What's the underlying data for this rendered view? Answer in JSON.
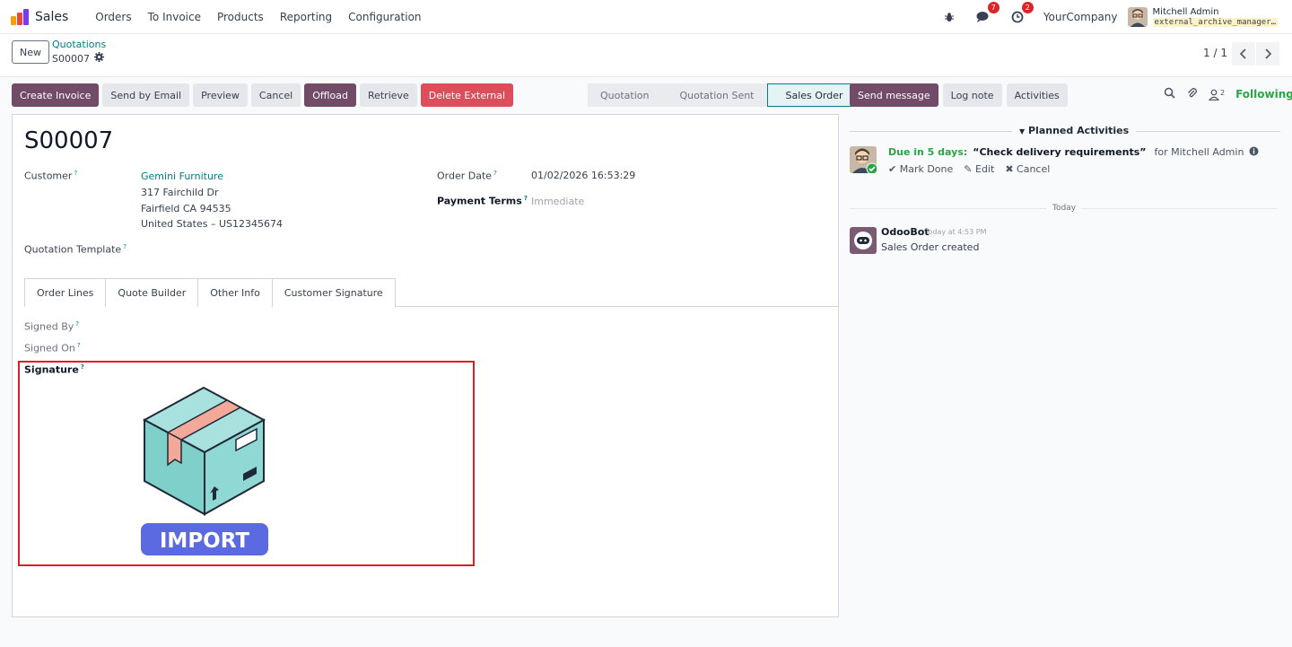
{
  "navbar": {
    "app_name": "Sales",
    "menu": [
      "Orders",
      "To Invoice",
      "Products",
      "Reporting",
      "Configuration"
    ],
    "messages_badge": "7",
    "activities_badge": "2",
    "company": "YourCompany",
    "user_name": "Mitchell Admin",
    "database": "external_archive_manager…"
  },
  "control_panel": {
    "new_label": "New",
    "breadcrumb_parent": "Quotations",
    "breadcrumb_current": "S00007",
    "pager": "1 / 1"
  },
  "actions": {
    "create_invoice": "Create Invoice",
    "send_by_email": "Send by Email",
    "preview": "Preview",
    "cancel": "Cancel",
    "offload": "Offload",
    "retrieve": "Retrieve",
    "delete_external": "Delete External"
  },
  "statusbar": [
    "Quotation",
    "Quotation Sent",
    "Sales Order"
  ],
  "form": {
    "title": "S00007",
    "customer_label": "Customer",
    "customer_name": "Gemini Furniture",
    "address_line1": "317 Fairchild Dr",
    "address_line2": "Fairfield CA 94535",
    "address_line3": "United States – US12345674",
    "quotation_template_label": "Quotation Template",
    "order_date_label": "Order Date",
    "order_date": "01/02/2026 16:53:29",
    "payment_terms_label": "Payment Terms",
    "payment_terms": "Immediate",
    "tabs": [
      "Order Lines",
      "Quote Builder",
      "Other Info",
      "Customer Signature"
    ],
    "signed_by_label": "Signed By",
    "signed_on_label": "Signed On",
    "signature_label": "Signature",
    "import_text": "IMPORT"
  },
  "chatter": {
    "send_message": "Send message",
    "log_note": "Log note",
    "activities": "Activities",
    "followers_count": "2",
    "following": "Following",
    "planned_activities": "Planned Activities",
    "due": "Due in 5 days:",
    "activity_summary": "“Check delivery requirements”",
    "activity_for": "for Mitchell Admin",
    "mark_done": "Mark Done",
    "edit": "Edit",
    "cancel": "Cancel",
    "today": "Today",
    "bot_name": "OdooBot",
    "bot_time": "Today at 4:53 PM",
    "bot_message": "Sales Order created"
  },
  "colors": {
    "primary": "#714b67",
    "link": "#017e84",
    "danger": "#dc4e5a",
    "highlight_frame": "#dc1f26",
    "box_teal": "#7fcfcb",
    "tape_pink": "#f2a99a",
    "import_banner": "#5b6ae0"
  },
  "icons": [
    "bug-icon",
    "chat-icon",
    "clock-icon",
    "gear-icon",
    "search-icon",
    "paperclip-icon",
    "user-icon",
    "info-icon"
  ]
}
